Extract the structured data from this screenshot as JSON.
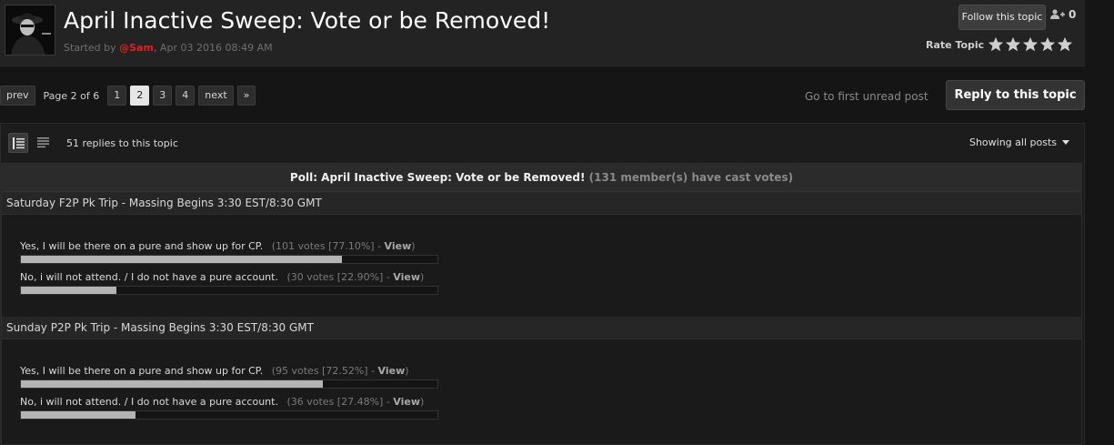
{
  "topic": {
    "title": "April Inactive Sweep: Vote or be Removed!",
    "started_prefix": "Started by",
    "author": "@Sam",
    "date": ", Apr 03 2016 08:49 AM",
    "follow_label": "Follow this topic",
    "follower_count": "0",
    "rate_label": "Rate Topic",
    "stars": 5
  },
  "pagination": {
    "prev": "prev",
    "page_label": "Page 2 of 6",
    "pages": [
      "1",
      "2",
      "3",
      "4"
    ],
    "current": "2",
    "next": "next",
    "last": "»",
    "first_unread": "Go to first unread post",
    "reply": "Reply to this topic"
  },
  "posts_bar": {
    "reply_count": "51 replies to this topic",
    "showing": "Showing all posts"
  },
  "poll": {
    "title": "Poll: April Inactive Sweep: Vote or be Removed!",
    "votes_note": "(131 member(s) have cast votes)",
    "questions": [
      {
        "title": "Saturday F2P Pk Trip - Massing Begins 3:30 EST/8:30 GMT",
        "choices": [
          {
            "label": "Yes, I will be there on a pure and show up for CP.",
            "stat": "(101 votes [77.10%] -",
            "view": "View",
            "close": ")",
            "percent": 77.1
          },
          {
            "label": "No, i will not attend. / I do not have a pure account.",
            "stat": "(30 votes [22.90%] -",
            "view": "View",
            "close": ")",
            "percent": 22.9
          }
        ]
      },
      {
        "title": "Sunday P2P Pk Trip - Massing Begins 3:30 EST/8:30 GMT",
        "choices": [
          {
            "label": "Yes, I will be there on a pure and show up for CP.",
            "stat": "(95 votes [72.52%] -",
            "view": "View",
            "close": ")",
            "percent": 72.52
          },
          {
            "label": "No, i will not attend. / I do not have a pure account.",
            "stat": "(36 votes [27.48%] -",
            "view": "View",
            "close": ")",
            "percent": 27.48
          }
        ]
      }
    ]
  },
  "colors": {
    "author": "#e02020",
    "bar_fill": "#b4b4b4",
    "background": "#151515"
  }
}
